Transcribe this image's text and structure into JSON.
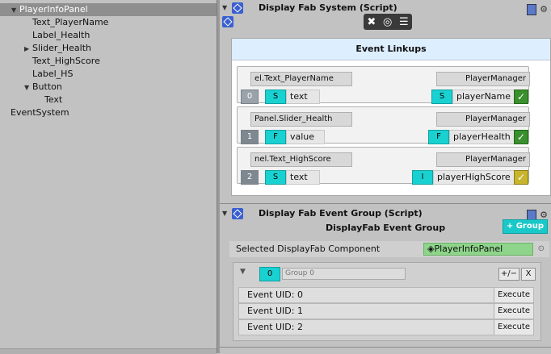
{
  "hierarchy": {
    "items": [
      {
        "label": "PlayerInfoPanel",
        "indent": 1,
        "expanded": true,
        "selected": true
      },
      {
        "label": "Text_PlayerName",
        "indent": 2
      },
      {
        "label": "Label_Health",
        "indent": 2
      },
      {
        "label": "Slider_Health",
        "indent": 2,
        "collapsed": true
      },
      {
        "label": "Text_HighScore",
        "indent": 2
      },
      {
        "label": "Label_HS",
        "indent": 2
      },
      {
        "label": "Button",
        "indent": 2,
        "expanded": true
      },
      {
        "label": "Text",
        "indent": 3
      },
      {
        "label": "EventSystem",
        "indent": 0
      }
    ]
  },
  "system": {
    "title": "Display Fab System (Script)",
    "panel_title": "Event Linkups",
    "linkups": [
      {
        "source": "el.Text_PlayerName",
        "target": "PlayerManager",
        "index": "0",
        "src_type": "S",
        "src_field": "text",
        "tgt_type": "S",
        "tgt_field": "playerName",
        "status": "ok"
      },
      {
        "source": "Panel.Slider_Health",
        "target": "PlayerManager",
        "index": "1",
        "src_type": "F",
        "src_field": "value",
        "tgt_type": "F",
        "tgt_field": "playerHealth",
        "status": "ok"
      },
      {
        "source": "nel.Text_HighScore",
        "target": "PlayerManager",
        "index": "2",
        "src_type": "S",
        "src_field": "text",
        "tgt_type": "I",
        "tgt_field": "playerHighScore",
        "status": "warn"
      }
    ]
  },
  "group": {
    "title": "Display Fab Event Group (Script)",
    "subtitle": "DisplayFab Event Group",
    "add_button": "+ Group",
    "selected_label": "Selected DisplayFab Component",
    "selected_value": "PlayerInfoPanel",
    "group_index": "0",
    "group_placeholder": "Group 0",
    "plusminus": "+/−",
    "close": "X",
    "events": [
      {
        "label": "Event UID: 0",
        "action": "Execute"
      },
      {
        "label": "Event UID: 1",
        "action": "Execute"
      },
      {
        "label": "Event UID: 2",
        "action": "Execute"
      }
    ]
  },
  "colors": {
    "accent": "#19d1d1",
    "ok": "#3a8f2e",
    "warn": "#c7b52e",
    "selected_field": "#8ed48a"
  }
}
